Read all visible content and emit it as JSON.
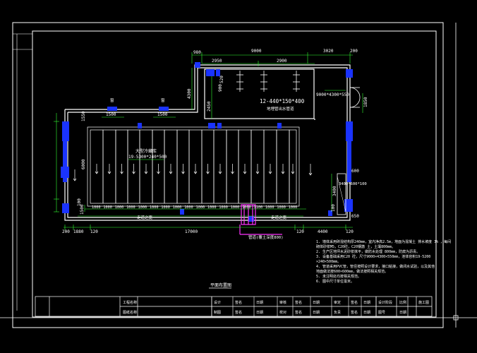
{
  "colors": {
    "background": "#000000",
    "frame": "#ffffff",
    "dimension": "#33ff33",
    "wall": "#ffffff",
    "column": "#1a33ff",
    "accent": "#ff33ff",
    "label": "#ffffff"
  },
  "dims": {
    "top_980": "980",
    "top_9000": "9000",
    "top_3020": "3020",
    "top_200": "200",
    "in_2950": "2950",
    "in_2900": "2900",
    "v_4300": "4300",
    "v_520": "520",
    "v_900": "900",
    "v_2450": "2450",
    "v_1550": "1550",
    "v_6000": "6000",
    "v_1500": "1500",
    "v_100a": "100",
    "v_100b": "100",
    "v_1850": "1850",
    "v_600": "600",
    "v_3400": "3400",
    "v_650": "650",
    "win_1500a": "1500",
    "win_1500b": "1500",
    "bottom_200": "200",
    "bottom_1880": "1880",
    "bottom_120a": "120",
    "bottom_17000": "17000",
    "bottom_120b": "120",
    "bottom_4400": "4400",
    "bottom_120c": "120",
    "spacing": [
      "1000",
      "1000",
      "1000",
      "1000",
      "1000",
      "1000",
      "1000",
      "1000",
      "1000",
      "1000",
      "1000",
      "1000",
      "1000",
      "1000",
      "1100",
      "1000",
      "1000",
      "1000"
    ]
  },
  "labels": {
    "equip_spec": "12-440*150*400",
    "equip_name": "地埋管出水管道",
    "pond_name": "大型冷藏库",
    "pond_spec": "19-5300*240*500",
    "tank_spec": "9000*4300*550",
    "small_tank": "3400*600*100",
    "walk_left": "走道之宽",
    "walk_right": "走道之宽",
    "pipe_note": "管道(覆土深度800)",
    "window_a": "窗",
    "window_b": "窗",
    "drawing_title": "平面布置图"
  },
  "notes": [
    "1.  墙体采用砖混结构厚240mm，室内净高2.5m，地面为混凝土 排水坡度 3% ，每间",
    "    砌体砂浆M5，C20砼，C20钢筋 土，土壤800mm。",
    "2.  生产区地坪水泥砂浆抹平，做防水处理 800mm，防腐为沥青。",
    "3.  设备基础采用C20 砼，尺寸9000×4300×550mm，池体容积19-5200",
    "    ×240×500mm。",
    "4.  管道采用PVC管，管径按照设计要求，接口粘接，做闭水试验，以及其他",
    "    地面做法按600×600mm，做法按照相关规范。",
    "5.  未注明处均按相关规范。",
    "6.  图中尺寸单位毫米。"
  ],
  "title_block": {
    "left_top": "工程名称",
    "left_bottom": "图纸名称",
    "row1": [
      "设计",
      "签名",
      "日期",
      "审核",
      "签名",
      "日期",
      "审定",
      "签名",
      "日期"
    ],
    "row2": [
      "制图",
      "签名",
      "日期",
      "校对",
      "签名",
      "日期",
      "负责",
      "签名",
      "日期"
    ],
    "right_top": [
      "设计阶段",
      "比例",
      "施工图"
    ],
    "right_bottom": [
      "图号",
      "日期"
    ]
  }
}
